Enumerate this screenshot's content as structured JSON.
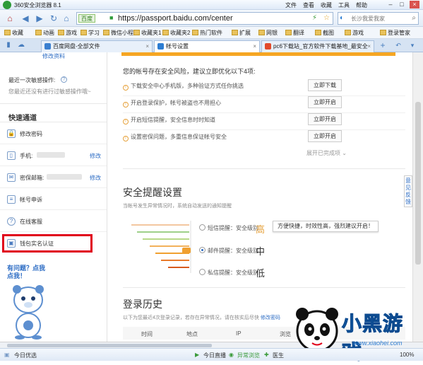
{
  "browser": {
    "title": "360安全浏览器 8.1",
    "menu": [
      "文件",
      "查看",
      "收藏",
      "工具",
      "帮助"
    ],
    "url_badge": "百度",
    "url": "https://passport.baidu.com/center",
    "search_placeholder": "长沙我爱我家"
  },
  "favorites": [
    "收藏",
    "动画",
    "游戏",
    "学习",
    "微信小程",
    "收藏夹1",
    "收藏夹2",
    "热门软件",
    "扩展",
    "网银",
    "翻译",
    "截图",
    "游戏",
    "登录管家"
  ],
  "tabs": [
    {
      "label": "百度网盘-全部文件",
      "active": false
    },
    {
      "label": "帐号设置",
      "active": true
    },
    {
      "label": "pc6下载站_官方软件下载基地_最安全",
      "active": false
    }
  ],
  "sidebar": {
    "top_link": "修改资料",
    "recent_title": "最近一次敏感操作:",
    "recent_text": "您最近还没有进行过敏感操作哦~",
    "quick_title": "快速通道",
    "items": [
      {
        "label": "修改密码",
        "icon": "lock-icon",
        "edit": ""
      },
      {
        "label": "手机:",
        "icon": "phone-icon",
        "edit": "修改"
      },
      {
        "label": "密保邮箱:",
        "icon": "mail-icon",
        "edit": "修改"
      },
      {
        "label": "帐号申诉",
        "icon": "appeal-icon",
        "edit": ""
      },
      {
        "label": "在线客服",
        "icon": "help-icon",
        "edit": ""
      },
      {
        "label": "钱包实名认证",
        "icon": "id-card-icon",
        "edit": ""
      }
    ],
    "mascot_text": "有问题？点我点我！"
  },
  "main": {
    "risk_title": "您的帐号存在安全风险，建议立即优化以下4项:",
    "risks": [
      {
        "text": "下载安全中心手机版，多种验证方式任你挑选",
        "button": "立即下载"
      },
      {
        "text": "开启登录保护，帐号被盗也不用担心",
        "button": "立即开启"
      },
      {
        "text": "开启短信提醒，安全信息时时知道",
        "button": "立即开启"
      },
      {
        "text": "设置密保问题，多重信息保证帐号安全",
        "button": "立即开启"
      }
    ],
    "collapse": "展开已完成项",
    "alert_title": "安全提醒设置",
    "alert_sub": "当帐号发生异常情况时，系统自动发送的通知提醒",
    "options": [
      {
        "label": "短信提醒：安全级别",
        "level": "高",
        "selected": false
      },
      {
        "label": "邮件提醒：安全级别",
        "level": "中",
        "selected": true
      },
      {
        "label": "私信提醒：安全级别",
        "level": "低",
        "selected": false
      }
    ],
    "tip": "方便快捷，时效性高，强烈建议开启！",
    "feedback": "意见反馈",
    "history_title": "登录历史",
    "history_sub": "以下为您最近4次登录记录，若存在异常情况，请在核实后尽快",
    "history_link": "修改密码",
    "columns": [
      "时间",
      "地点",
      "IP",
      "浏览"
    ]
  },
  "status": {
    "left": "今日优选",
    "live": "今日直播",
    "speed": "异常浏览",
    "doctor": "医生",
    "zoom": "100%"
  },
  "watermark": {
    "brand": "小黑游戏",
    "domain": "www.xiaohei.com"
  },
  "colors": {
    "accent": "#2c6cc4",
    "warning": "#e6a23c",
    "highlight": "#e0001b",
    "orange": "#f6a623"
  }
}
